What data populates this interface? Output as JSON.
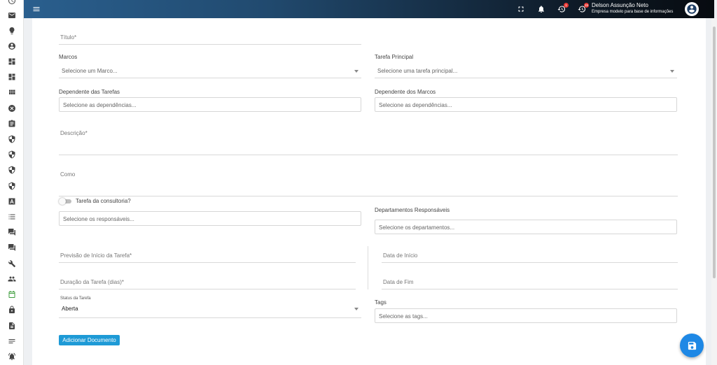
{
  "topbar": {
    "user_name": "Delson Assunção Neto",
    "user_company": "Empresa modelo para base de informações",
    "badges": {
      "history_1": "1",
      "history_2": "15"
    },
    "icons": [
      "menu-icon",
      "fullscreen-icon",
      "bell-icon",
      "history-icon",
      "history-icon",
      "account-icon"
    ]
  },
  "sidebar": {
    "icons": [
      "clock-icon",
      "mail-icon",
      "lightbulb-icon",
      "account-circle-icon",
      "dashboard-icon",
      "dashboard-icon",
      "grid-icon",
      "cancel-circle-icon",
      "clipboard-icon",
      "shield-icon",
      "shield-icon",
      "shield-icon",
      "shield-icon",
      "font-box-icon",
      "list-icon",
      "forum-icon",
      "forum-icon",
      "tools-icon",
      "group-icon",
      "calendar-icon",
      "lock-icon",
      "file-icon",
      "notes-icon",
      "alarm-icon"
    ],
    "active_color": "#3e9d3c"
  },
  "form": {
    "titulo": {
      "label": "Título*"
    },
    "marcos": {
      "label": "Marcos",
      "placeholder": "Selecione um Marco..."
    },
    "tarefa_principal": {
      "label": "Tarefa Principal",
      "placeholder": "Selecione uma tarefa principal..."
    },
    "dep_tarefas": {
      "label": "Dependente das Tarefas",
      "placeholder": "Selecione as dependências..."
    },
    "dep_marcos": {
      "label": "Dependente dos Marcos",
      "placeholder": "Selecione as dependências..."
    },
    "descricao": {
      "label": "Descrição*"
    },
    "como": {
      "label": "Como"
    },
    "consultoria_toggle": {
      "label": "Tarefa da consultoria?",
      "checked": false
    },
    "responsaveis": {
      "placeholder": "Selecione os responsáveis..."
    },
    "departamentos": {
      "label": "Departamentos Responsáveis",
      "placeholder": "Selecione os departamentos..."
    },
    "previsao_inicio": {
      "label": "Previsão de Início da Tarefa*"
    },
    "data_inicio": {
      "label": "Data de Início"
    },
    "duracao": {
      "label": "Duração da Tarefa (dias)*"
    },
    "data_fim": {
      "label": "Data de Fim"
    },
    "status": {
      "label": "Status da Tarefa",
      "value": "Aberta"
    },
    "tags": {
      "label": "Tags",
      "placeholder": "Selecione as tags..."
    },
    "add_doc_label": "Adicionar Documento"
  },
  "colors": {
    "primary_button": "#1e9ad6",
    "fab": "#1e88e5"
  }
}
